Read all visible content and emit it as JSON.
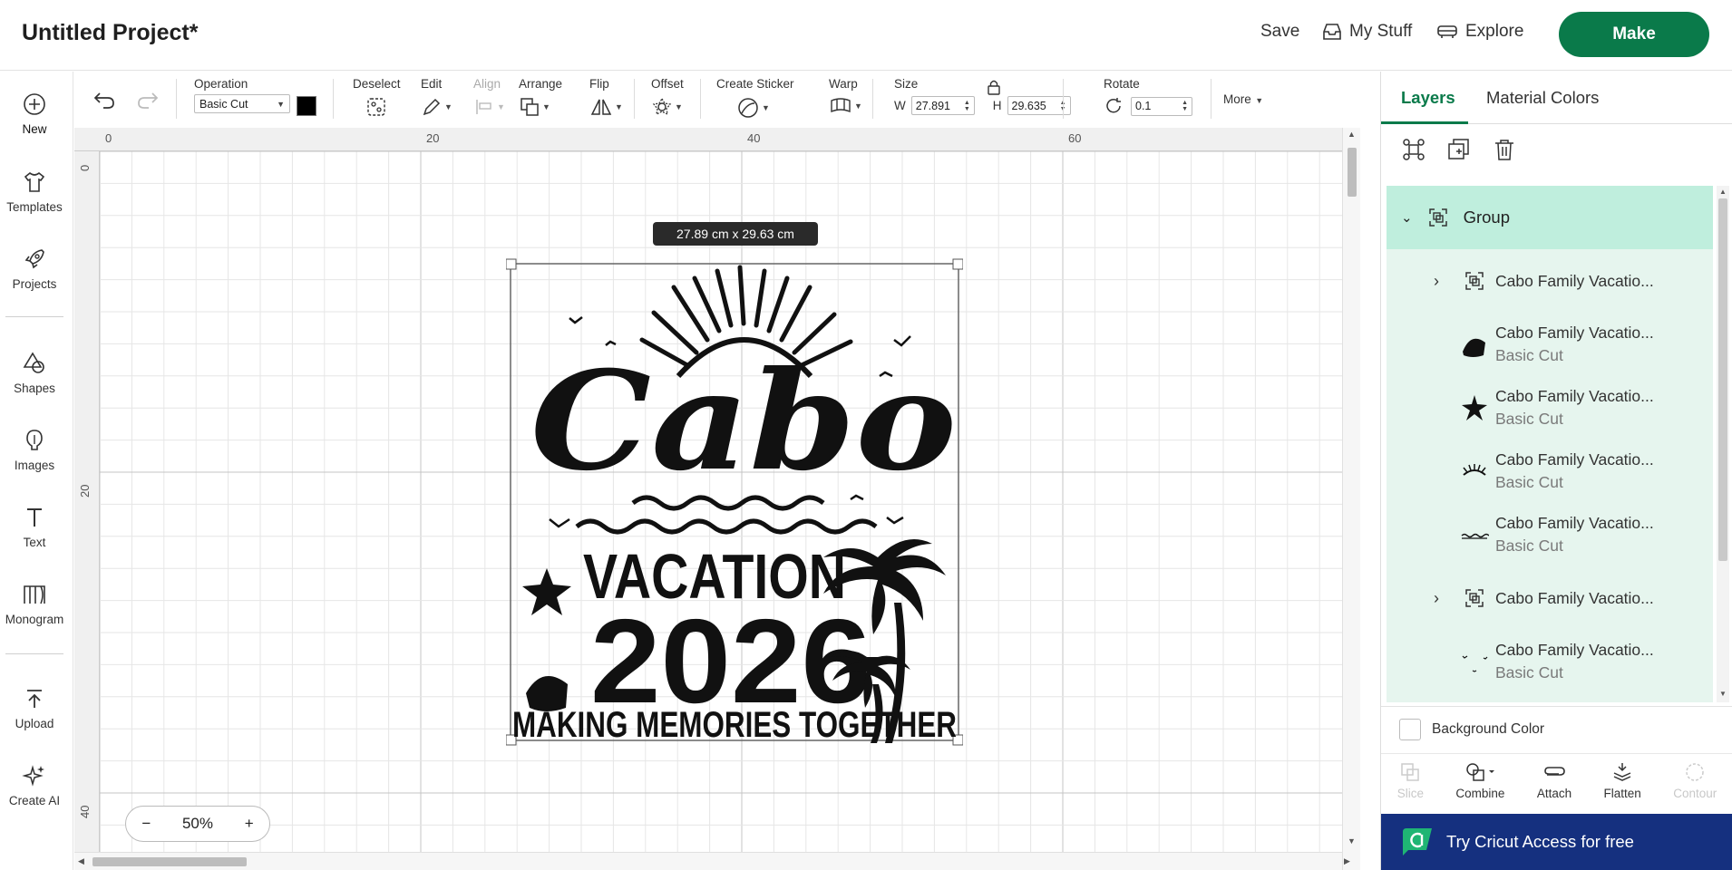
{
  "header": {
    "title": "Untitled Project*",
    "save_label": "Save",
    "my_stuff_label": "My Stuff",
    "explore_label": "Explore",
    "make_label": "Make"
  },
  "leftnav": {
    "items": [
      {
        "label": "New",
        "icon": "plus-circle-icon"
      },
      {
        "label": "Templates",
        "icon": "shirt-icon"
      },
      {
        "label": "Projects",
        "icon": "rocket-icon"
      },
      {
        "label": "Shapes",
        "icon": "shapes-icon"
      },
      {
        "label": "Images",
        "icon": "lightbulb-icon"
      },
      {
        "label": "Text",
        "icon": "text-icon"
      },
      {
        "label": "Monogram",
        "icon": "monogram-icon"
      },
      {
        "label": "Upload",
        "icon": "upload-icon"
      },
      {
        "label": "Create AI",
        "icon": "sparkle-icon"
      }
    ]
  },
  "toolbar": {
    "operation_label": "Operation",
    "operation_value": "Basic Cut",
    "deselect_label": "Deselect",
    "edit_label": "Edit",
    "align_label": "Align",
    "arrange_label": "Arrange",
    "flip_label": "Flip",
    "offset_label": "Offset",
    "create_sticker_label": "Create Sticker",
    "warp_label": "Warp",
    "size_label": "Size",
    "w_label": "W",
    "w_value": "27.891",
    "h_label": "H",
    "h_value": "29.635",
    "rotate_label": "Rotate",
    "rotate_value": "0.1",
    "more_label": "More"
  },
  "canvas": {
    "ruler_top": [
      "0",
      "20",
      "40",
      "60"
    ],
    "ruler_left": [
      "0",
      "20",
      "40"
    ],
    "dimension_tooltip": "27.89  cm x 29.63  cm",
    "zoom_level": "50%",
    "zoom_minus": "−",
    "zoom_plus": "+"
  },
  "design": {
    "word1": "Cabo",
    "word2": "VACATION",
    "word3": "2026",
    "word4": "MAKING MEMORIES TOGETHER"
  },
  "rightpanel": {
    "tabs": [
      "Layers",
      "Material Colors"
    ],
    "group_label": "Group",
    "layers": [
      {
        "name": "Cabo Family Vacatio...",
        "sub": "",
        "expandable": true,
        "thumb": "group-icon"
      },
      {
        "name": "Cabo Family Vacatio...",
        "sub": "Basic Cut",
        "expandable": false,
        "thumb": "shell-icon"
      },
      {
        "name": "Cabo Family Vacatio...",
        "sub": "Basic Cut",
        "expandable": false,
        "thumb": "starfish-icon"
      },
      {
        "name": "Cabo Family Vacatio...",
        "sub": "Basic Cut",
        "expandable": false,
        "thumb": "sun-rays-icon"
      },
      {
        "name": "Cabo Family Vacatio...",
        "sub": "Basic Cut",
        "expandable": false,
        "thumb": "waves-icon"
      },
      {
        "name": "Cabo Family Vacatio...",
        "sub": "",
        "expandable": true,
        "thumb": "group-icon"
      },
      {
        "name": "Cabo Family Vacatio...",
        "sub": "Basic Cut",
        "expandable": false,
        "thumb": "birds-icon"
      }
    ],
    "background_color_label": "Background Color",
    "bottom_tools": [
      "Slice",
      "Combine",
      "Attach",
      "Flatten",
      "Contour"
    ],
    "promo_label": "Try Cricut Access for free"
  }
}
